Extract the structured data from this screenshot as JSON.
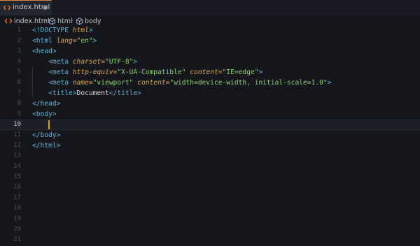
{
  "tab": {
    "filename": "index.html",
    "icon": "html-file-icon"
  },
  "breadcrumb": {
    "file": "index.html",
    "html": "html",
    "body": "body",
    "separator": "›"
  },
  "lines": [
    {
      "n": "1",
      "segs": [
        [
          "t-tag",
          "<!DOCTYPE "
        ],
        [
          "t-attr",
          "html"
        ],
        [
          "t-tag",
          ">"
        ]
      ]
    },
    {
      "n": "2",
      "segs": [
        [
          "t-tag",
          "<html "
        ],
        [
          "t-attr",
          "lang"
        ],
        [
          "t-eq",
          "="
        ],
        [
          "t-str",
          "\"en\""
        ],
        [
          "t-tag",
          ">"
        ]
      ]
    },
    {
      "n": "3",
      "segs": [
        [
          "t-tag",
          "<head>"
        ]
      ]
    },
    {
      "n": "4",
      "segs": [
        [
          "t-text",
          "    "
        ],
        [
          "t-tag",
          "<meta "
        ],
        [
          "t-attr",
          "charset"
        ],
        [
          "t-eq",
          "="
        ],
        [
          "t-str",
          "\"UTF-8\""
        ],
        [
          "t-tag",
          ">"
        ]
      ]
    },
    {
      "n": "5",
      "segs": [
        [
          "t-text",
          "    "
        ],
        [
          "t-tag",
          "<meta "
        ],
        [
          "t-attr",
          "http-equiv"
        ],
        [
          "t-eq",
          "="
        ],
        [
          "t-str",
          "\"X-UA-Compatible\""
        ],
        [
          "t-text",
          " "
        ],
        [
          "t-attr",
          "content"
        ],
        [
          "t-eq",
          "="
        ],
        [
          "t-str",
          "\"IE=edge\""
        ],
        [
          "t-tag",
          ">"
        ]
      ]
    },
    {
      "n": "6",
      "segs": [
        [
          "t-text",
          "    "
        ],
        [
          "t-tag",
          "<meta "
        ],
        [
          "t-attr",
          "name"
        ],
        [
          "t-eq",
          "="
        ],
        [
          "t-str",
          "\"viewport\""
        ],
        [
          "t-text",
          " "
        ],
        [
          "t-attr",
          "content"
        ],
        [
          "t-eq",
          "="
        ],
        [
          "t-str",
          "\"width=device-width, initial-scale=1.0\""
        ],
        [
          "t-tag",
          ">"
        ]
      ]
    },
    {
      "n": "7",
      "segs": [
        [
          "t-text",
          "    "
        ],
        [
          "t-tag",
          "<title>"
        ],
        [
          "t-text",
          "Document"
        ],
        [
          "t-tag",
          "</title>"
        ]
      ]
    },
    {
      "n": "8",
      "segs": [
        [
          "t-tag",
          "</head>"
        ]
      ]
    },
    {
      "n": "9",
      "segs": [
        [
          "t-tag",
          "<body>"
        ]
      ]
    },
    {
      "n": "10",
      "segs": []
    },
    {
      "n": "11",
      "segs": [
        [
          "t-tag",
          "</body>"
        ]
      ]
    },
    {
      "n": "12",
      "segs": [
        [
          "t-tag",
          "</html>"
        ]
      ]
    },
    {
      "n": "13",
      "segs": []
    },
    {
      "n": "14",
      "segs": []
    },
    {
      "n": "15",
      "segs": []
    },
    {
      "n": "16",
      "segs": []
    },
    {
      "n": "17",
      "segs": []
    },
    {
      "n": "18",
      "segs": []
    },
    {
      "n": "19",
      "segs": []
    },
    {
      "n": "20",
      "segs": []
    },
    {
      "n": "21",
      "segs": []
    }
  ],
  "active_line": "10"
}
